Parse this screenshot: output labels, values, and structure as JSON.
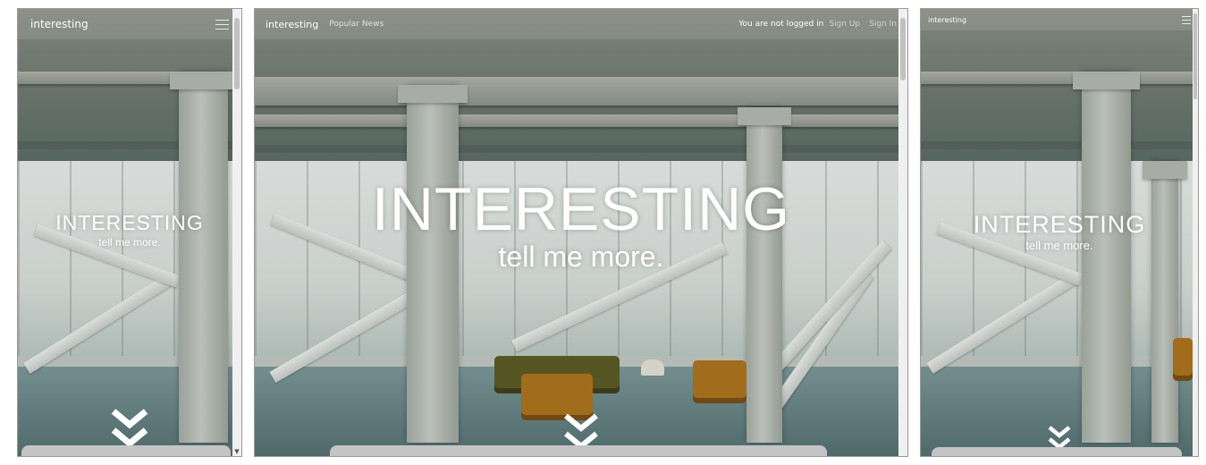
{
  "panels": [
    {
      "variant": "mobile",
      "topbar": {
        "brand": "interesting",
        "menu_icon": "hamburger-icon"
      },
      "hero": {
        "title": "INTERESTING",
        "subtitle": "tell me more."
      },
      "scroll_icon": "double-chevron-down-icon"
    },
    {
      "variant": "desktop",
      "topbar": {
        "brand": "interesting",
        "nav": [
          "Popular News"
        ],
        "status": "You are not logged in",
        "sign_up": "Sign Up",
        "sign_in": "Sign In"
      },
      "hero": {
        "title": "INTERESTING",
        "subtitle": "tell me more."
      },
      "scroll_icon": "double-chevron-down-icon"
    },
    {
      "variant": "tablet",
      "topbar": {
        "brand": "interesting",
        "menu_icon": "hamburger-icon"
      },
      "hero": {
        "title": "INTERESTING",
        "subtitle": "tell me more."
      },
      "scroll_icon": "double-chevron-down-icon"
    }
  ],
  "colors": {
    "hero_text": "#ffffff",
    "bottom_bar": "#c4c4c4"
  }
}
